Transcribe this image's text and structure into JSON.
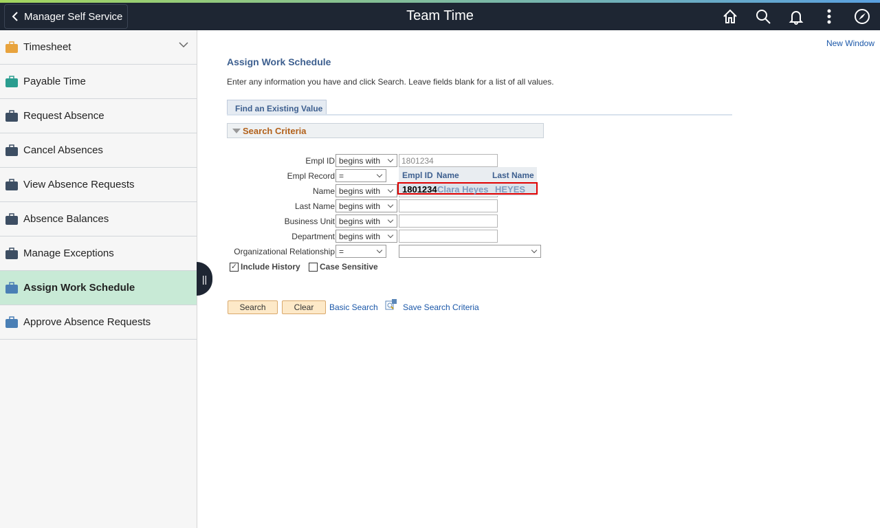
{
  "header": {
    "back_label": "Manager Self Service",
    "title": "Team Time",
    "icons": [
      "home-icon",
      "search-icon",
      "bell-icon",
      "more-vertical-icon",
      "compass-icon"
    ]
  },
  "sidebar": {
    "items": [
      {
        "label": "Timesheet",
        "icon": "person-clock-icon",
        "expandable": true
      },
      {
        "label": "Payable Time",
        "icon": "clock-money-icon"
      },
      {
        "label": "Request Absence",
        "icon": "briefcase-icon"
      },
      {
        "label": "Cancel Absences",
        "icon": "briefcase-cancel-icon"
      },
      {
        "label": "View Absence Requests",
        "icon": "briefcase-calendar-icon"
      },
      {
        "label": "Absence Balances",
        "icon": "briefcase-balance-icon"
      },
      {
        "label": "Manage Exceptions",
        "icon": "clock-alert-icon"
      },
      {
        "label": "Assign Work Schedule",
        "icon": "schedule-icon",
        "active": true
      },
      {
        "label": "Approve Absence Requests",
        "icon": "schedule-icon"
      }
    ],
    "collapse_handle": "||"
  },
  "main": {
    "new_window": "New Window",
    "title": "Assign Work Schedule",
    "instructions": "Enter any information you have and click Search. Leave fields blank for a list of all values.",
    "tab": "Find an Existing Value",
    "section": "Search Criteria",
    "fields": [
      {
        "label": "Empl ID",
        "operator": "begins with",
        "value": "1801234"
      },
      {
        "label": "Empl Record",
        "operator": "=",
        "value": ""
      },
      {
        "label": "Name",
        "operator": "begins with",
        "value": ""
      },
      {
        "label": "Last Name",
        "operator": "begins with",
        "value": ""
      },
      {
        "label": "Business Unit",
        "operator": "begins with",
        "value": ""
      },
      {
        "label": "Department",
        "operator": "begins with",
        "value": ""
      },
      {
        "label": "Organizational Relationship",
        "operator": "=",
        "value": ""
      }
    ],
    "autocomplete": {
      "headers": [
        "Empl ID",
        "Name",
        "Last Name"
      ],
      "row": [
        "1801234",
        "Clara Heyes",
        "HEYES"
      ]
    },
    "include_history": {
      "label": "Include History",
      "checked": true
    },
    "case_sensitive": {
      "label": "Case Sensitive",
      "checked": false
    },
    "buttons": {
      "search": "Search",
      "clear": "Clear",
      "basic_search": "Basic Search",
      "save_criteria": "Save Search Criteria"
    }
  },
  "colors": {
    "topbar": "#1e2633",
    "active_item": "#c8ead6",
    "section_title": "#b2611b",
    "link": "#1a57a8",
    "highlight_border": "#e00000"
  }
}
